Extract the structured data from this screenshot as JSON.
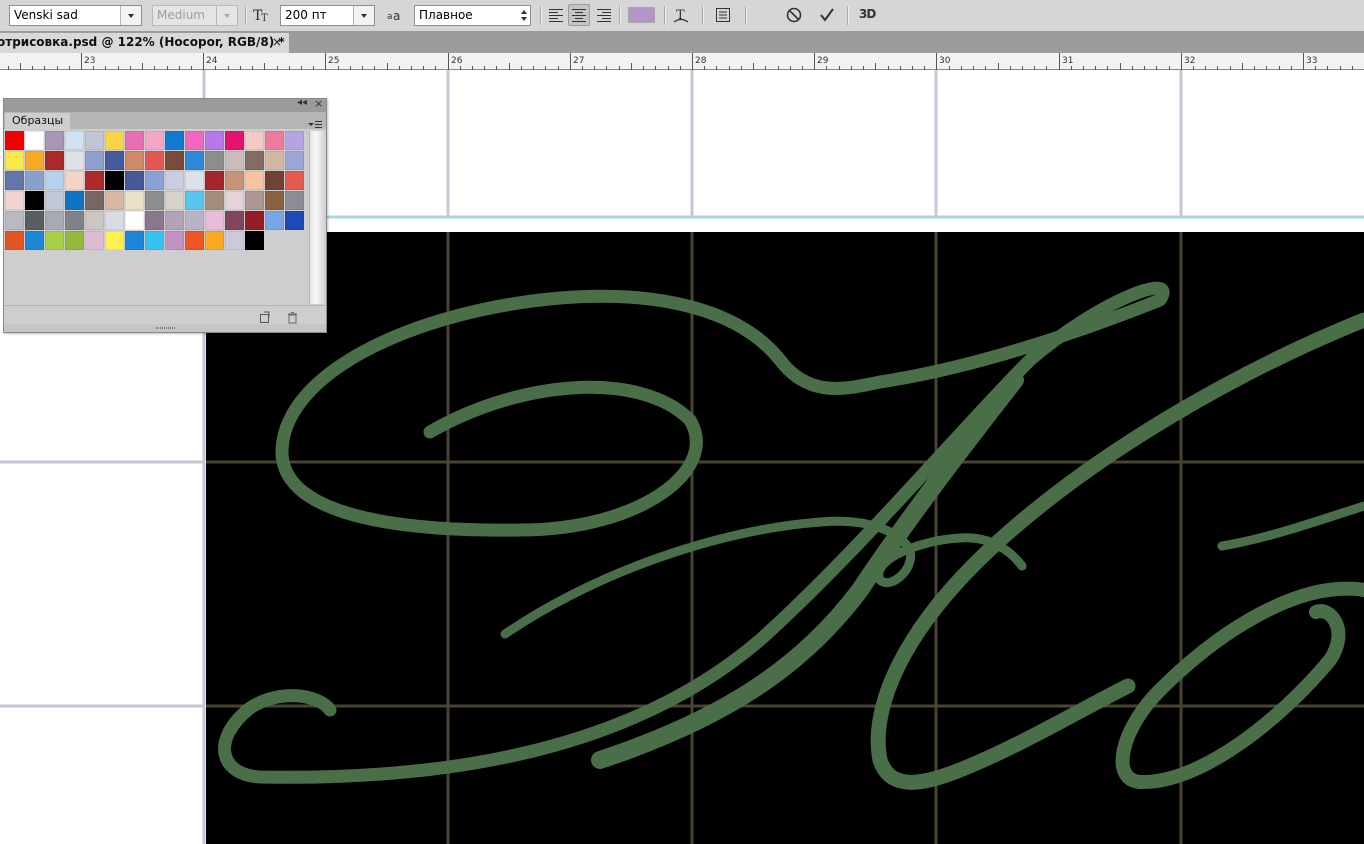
{
  "options_bar": {
    "font_family": "Venski sad",
    "font_style": "Medium",
    "font_size": "200 пт",
    "antialias": "Плавное",
    "text_color": "#b693c6",
    "icons": [
      "text-orientation-icon",
      "font-size-icon",
      "antialias-icon",
      "align-left-icon",
      "align-center-icon",
      "align-right-icon",
      "warp-text-icon",
      "character-panel-icon",
      "cancel-icon",
      "commit-icon"
    ],
    "threed_label": "3D"
  },
  "document_tab": {
    "title": "отрисовка.psd @ 122% (Нocopor, RGB/8) *",
    "close_label": "×"
  },
  "ruler": {
    "labels": [
      "23",
      "24",
      "25",
      "26",
      "27",
      "28",
      "29",
      "30",
      "31",
      "32",
      "33"
    ]
  },
  "swatches_panel": {
    "title": "Образцы",
    "collapse_label": "◂◂",
    "close_label": "×",
    "swatches": [
      [
        "#f20000",
        "#ffffff",
        "#a896b7",
        "#d0e3f1",
        "#c0c5d3",
        "#f8d548",
        "#e96fb5",
        "#f5a6c8",
        "#0f7ad0",
        "#f066c0",
        "#b478e8",
        "#e5126e",
        "#f7c9c4",
        "#f07a9e",
        "#b5a3e6"
      ],
      [
        "#f8e949",
        "#f9a925",
        "#ab2a27",
        "#e0e0e8",
        "#8f9fce",
        "#475a9e",
        "#ce8968",
        "#e35750",
        "#7a4b3b",
        "#2b89d6",
        "#8c8d8c",
        "#c8bdb8",
        "#846c64",
        "#d2b8a0",
        "#9ba6d9"
      ],
      [
        "#6275ad",
        "#89a0cf",
        "#b4d1ed",
        "#f5d4c7",
        "#ac2a27",
        "#000000",
        "#46589a",
        "#8c9fd6",
        "#c7cfe1",
        "#dbe2ea",
        "#a3262a",
        "#c79375",
        "#f7c3a3",
        "#6f4233",
        "#e45c50"
      ],
      [
        "#f2d5d0",
        "#000000",
        "#c0c7d6",
        "#0f73c6",
        "#766860",
        "#d8b7a2",
        "#ece0c6",
        "#8c8d8e",
        "#d8d2cd",
        "#57c5ee",
        "#a68b7d",
        "#e6d3d8",
        "#ae9694",
        "#8a6142",
        "#8c8c94"
      ],
      [
        "#b9b9c1",
        "#575e64",
        "#a5aab4",
        "#7d8387",
        "#cbc5c4",
        "#dadce5",
        "#ffffff",
        "#89778d",
        "#b2a2b8",
        "#bcb2c8",
        "#e8bcda",
        "#83445f",
        "#951d2a",
        "#78a5e8",
        "#1d4ab5"
      ],
      [
        "#e25524",
        "#1d88d8",
        "#a6cf45",
        "#94b83c",
        "#e0bad4",
        "#fef04e",
        "#1d86d8",
        "#37c3ef",
        "#c293c1",
        "#ee5424",
        "#f9a922",
        "#cec8dc",
        "#000000"
      ]
    ]
  },
  "canvas": {
    "guide_color": "#c3c8d6",
    "grid_color": "#4a4334",
    "text_layer_color": "#4a6e47",
    "text_layer_name": "Нocopor",
    "selection_line_color": "#a8d4e0"
  }
}
